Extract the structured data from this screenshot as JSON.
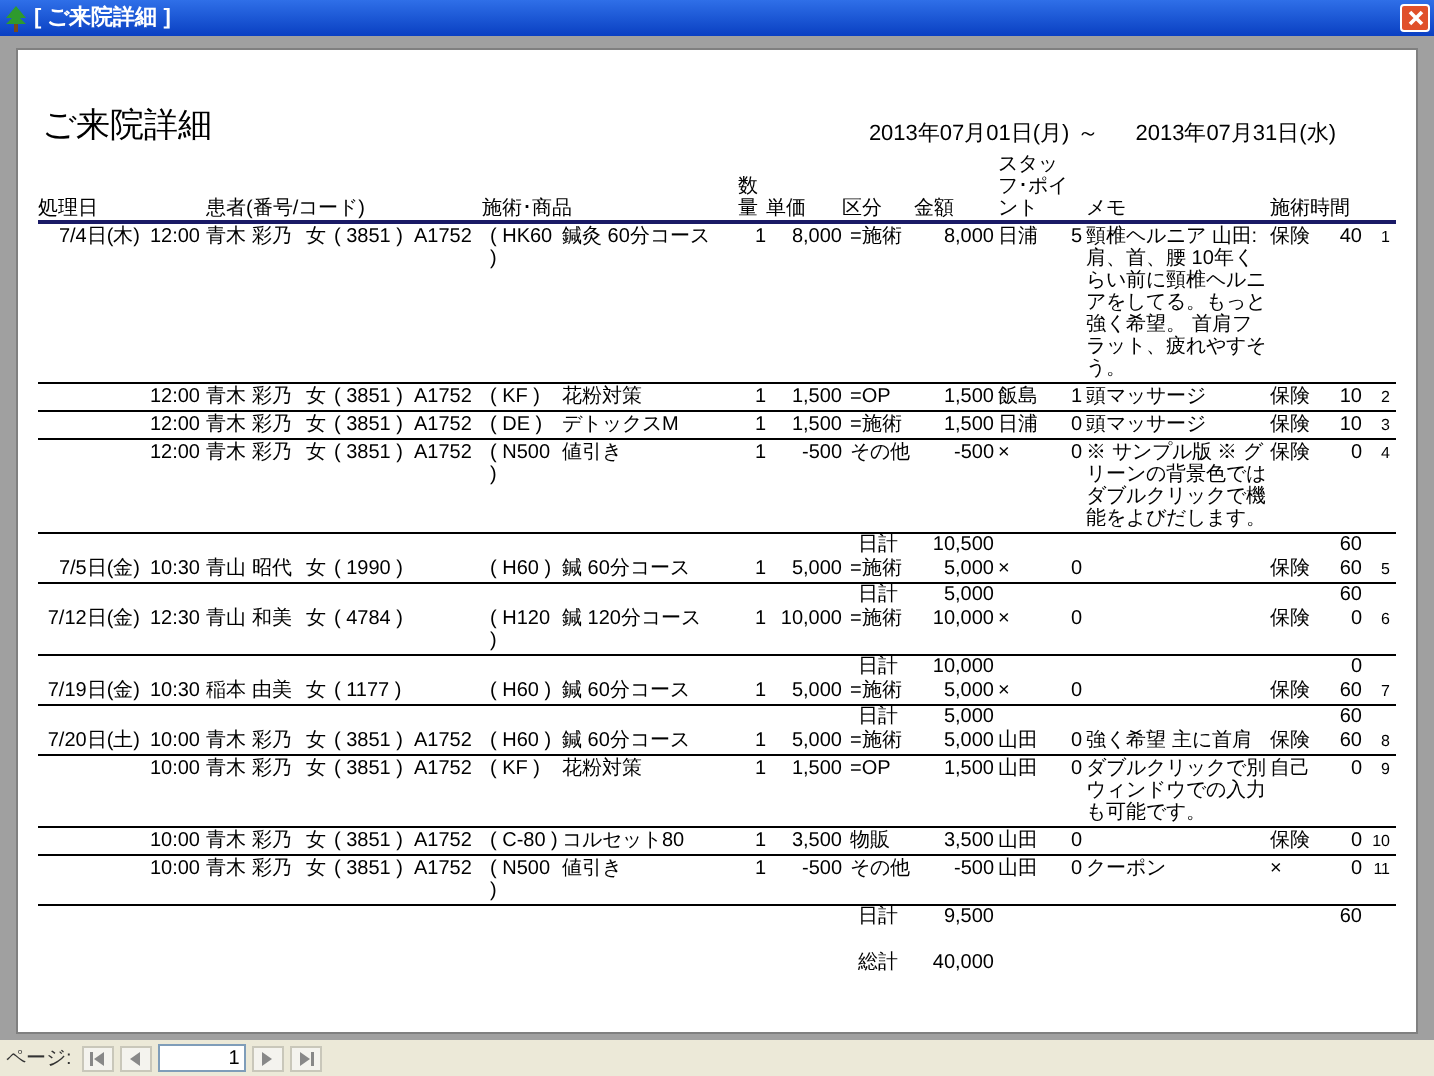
{
  "window": {
    "title": "[ ご来院詳細 ]"
  },
  "report": {
    "title": "ご来院詳細",
    "period_start": "2013年07月01日(月)",
    "separator": "～",
    "period_end": "2013年07月31日(水)",
    "columns": [
      "処理日",
      "患者(番号/コード)",
      "施術･商品",
      "数量",
      "単価",
      "区分",
      "金額",
      "スタッフ･ポイント",
      "メモ",
      "施術時間"
    ],
    "rows": [
      {
        "kind": "visit",
        "date": "7/4日(木)",
        "time": "12:00",
        "patient": "青木 彩乃",
        "gender": "女",
        "number": "( 3851 )",
        "code": "A1752",
        "item_code": "( HK60 )",
        "item": "鍼灸 60分コース",
        "qty": "1",
        "price": "8,000",
        "category": "=施術",
        "amount": "8,000",
        "staff": "日浦",
        "point": "5",
        "memo": "頸椎ヘルニア 山田:肩、首、腰 10年くらい前に頸椎ヘルニアをしてる。もっと強く希望。 首肩フラット、疲れやすそう。",
        "insurance": "保険",
        "minutes": "40",
        "no": "1"
      },
      {
        "kind": "visit",
        "time": "12:00",
        "patient": "青木 彩乃",
        "gender": "女",
        "number": "( 3851 )",
        "code": "A1752",
        "item_code": "( KF )",
        "item": "花粉対策",
        "qty": "1",
        "price": "1,500",
        "category": "=OP",
        "amount": "1,500",
        "staff": "飯島",
        "point": "1",
        "memo": "頭マッサージ",
        "insurance": "保険",
        "minutes": "10",
        "no": "2"
      },
      {
        "kind": "visit",
        "time": "12:00",
        "patient": "青木 彩乃",
        "gender": "女",
        "number": "( 3851 )",
        "code": "A1752",
        "item_code": "( DE )",
        "item": "デトックスM",
        "qty": "1",
        "price": "1,500",
        "category": "=施術",
        "amount": "1,500",
        "staff": "日浦",
        "point": "0",
        "memo": "頭マッサージ",
        "insurance": "保険",
        "minutes": "10",
        "no": "3"
      },
      {
        "kind": "visit",
        "time": "12:00",
        "patient": "青木 彩乃",
        "gender": "女",
        "number": "( 3851 )",
        "code": "A1752",
        "item_code": "( N500 )",
        "item": "値引き",
        "qty": "1",
        "price": "-500",
        "category": "その他",
        "amount": "-500",
        "staff": "×",
        "point": "0",
        "memo": "※ サンプル版 ※ グリーンの背景色ではダブルクリックで機能をよびだします。",
        "insurance": "保険",
        "minutes": "0",
        "no": "4"
      },
      {
        "kind": "subtotal",
        "label": "日計",
        "amount": "10,500",
        "minutes": "60"
      },
      {
        "kind": "visit",
        "date": "7/5日(金)",
        "time": "10:30",
        "patient": "青山 昭代",
        "gender": "女",
        "number": "( 1990 )",
        "item_code": "( H60 )",
        "item": "鍼 60分コース",
        "qty": "1",
        "price": "5,000",
        "category": "=施術",
        "amount": "5,000",
        "staff": "×",
        "point": "0",
        "insurance": "保険",
        "minutes": "60",
        "no": "5"
      },
      {
        "kind": "subtotal",
        "label": "日計",
        "amount": "5,000",
        "minutes": "60"
      },
      {
        "kind": "visit",
        "date": "7/12日(金)",
        "time": "12:30",
        "patient": "青山 和美",
        "gender": "女",
        "number": "( 4784 )",
        "item_code": "( H120 )",
        "item": "鍼 120分コース",
        "qty": "1",
        "price": "10,000",
        "category": "=施術",
        "amount": "10,000",
        "staff": "×",
        "point": "0",
        "insurance": "保険",
        "minutes": "0",
        "no": "6"
      },
      {
        "kind": "subtotal",
        "label": "日計",
        "amount": "10,000",
        "minutes": "0"
      },
      {
        "kind": "visit",
        "date": "7/19日(金)",
        "time": "10:30",
        "patient": "稲本 由美",
        "gender": "女",
        "number": "( 1177 )",
        "item_code": "( H60 )",
        "item": "鍼 60分コース",
        "qty": "1",
        "price": "5,000",
        "category": "=施術",
        "amount": "5,000",
        "staff": "×",
        "point": "0",
        "insurance": "保険",
        "minutes": "60",
        "no": "7"
      },
      {
        "kind": "subtotal",
        "label": "日計",
        "amount": "5,000",
        "minutes": "60"
      },
      {
        "kind": "visit",
        "date": "7/20日(土)",
        "time": "10:00",
        "patient": "青木 彩乃",
        "gender": "女",
        "number": "( 3851 )",
        "code": "A1752",
        "item_code": "( H60 )",
        "item": "鍼 60分コース",
        "qty": "1",
        "price": "5,000",
        "category": "=施術",
        "amount": "5,000",
        "staff": "山田",
        "point": "0",
        "memo": "強く希望 主に首肩",
        "insurance": "保険",
        "minutes": "60",
        "no": "8"
      },
      {
        "kind": "visit",
        "time": "10:00",
        "patient": "青木 彩乃",
        "gender": "女",
        "number": "( 3851 )",
        "code": "A1752",
        "item_code": "( KF )",
        "item": "花粉対策",
        "qty": "1",
        "price": "1,500",
        "category": "=OP",
        "amount": "1,500",
        "staff": "山田",
        "point": "0",
        "memo": "ダブルクリックで別ウィンドウでの入力も可能です。",
        "insurance": "自己",
        "minutes": "0",
        "no": "9"
      },
      {
        "kind": "visit",
        "time": "10:00",
        "patient": "青木 彩乃",
        "gender": "女",
        "number": "( 3851 )",
        "code": "A1752",
        "item_code": "( C-80 )",
        "item": "コルセット80",
        "qty": "1",
        "price": "3,500",
        "category": "物販",
        "amount": "3,500",
        "staff": "山田",
        "point": "0",
        "insurance": "保険",
        "minutes": "0",
        "no": "10"
      },
      {
        "kind": "visit",
        "time": "10:00",
        "patient": "青木 彩乃",
        "gender": "女",
        "number": "( 3851 )",
        "code": "A1752",
        "item_code": "( N500 )",
        "item": "値引き",
        "qty": "1",
        "price": "-500",
        "category": "その他",
        "amount": "-500",
        "staff": "山田",
        "point": "0",
        "memo": "クーポン",
        "insurance": "×",
        "minutes": "0",
        "no": "11"
      },
      {
        "kind": "subtotal",
        "label": "日計",
        "amount": "9,500",
        "minutes": "60"
      },
      {
        "kind": "total",
        "label": "総計",
        "amount": "40,000"
      }
    ]
  },
  "pager": {
    "label": "ページ:",
    "page": "1"
  }
}
